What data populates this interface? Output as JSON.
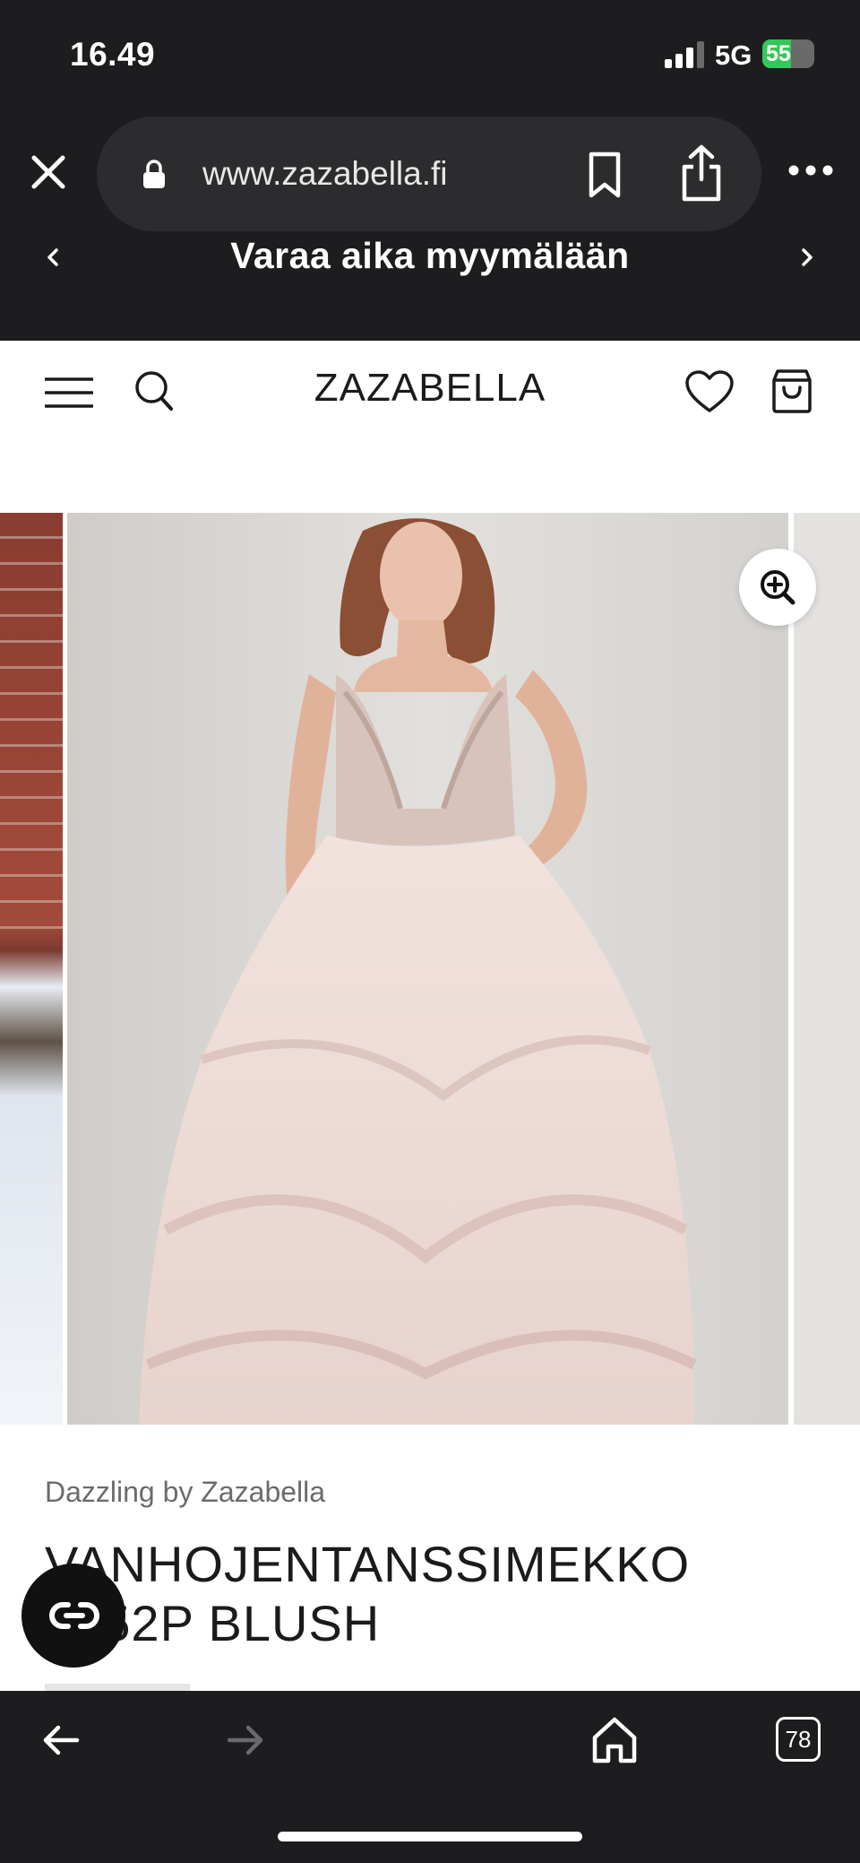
{
  "status_bar": {
    "time": "16.49",
    "network": "5G",
    "battery_level": "55",
    "battery_fraction": 0.55,
    "signal_bars_filled": 3
  },
  "browser": {
    "url": "www.zazabella.fi",
    "tabs_count": "78",
    "icons": [
      "close-icon",
      "lock-icon",
      "bookmark-icon",
      "share-icon",
      "more-icon",
      "back-arrow-icon",
      "forward-arrow-icon",
      "home-icon",
      "tabs-icon"
    ]
  },
  "promo_banner": {
    "text": "Varaa aika myymälään"
  },
  "header": {
    "logo": "ZAZABELLA",
    "icons": [
      "menu-icon",
      "search-icon",
      "heart-icon",
      "shopping-bag-icon"
    ]
  },
  "product": {
    "brand": "Dazzling by Zazabella",
    "title": "VANHOJENTANSSIMEKKO 1452P BLUSH"
  },
  "colors": {
    "chrome_dark": "#1d1d1f",
    "accent_battery": "#35c759",
    "text_dark": "#1b1b1b",
    "text_muted": "#6b6b6b"
  }
}
